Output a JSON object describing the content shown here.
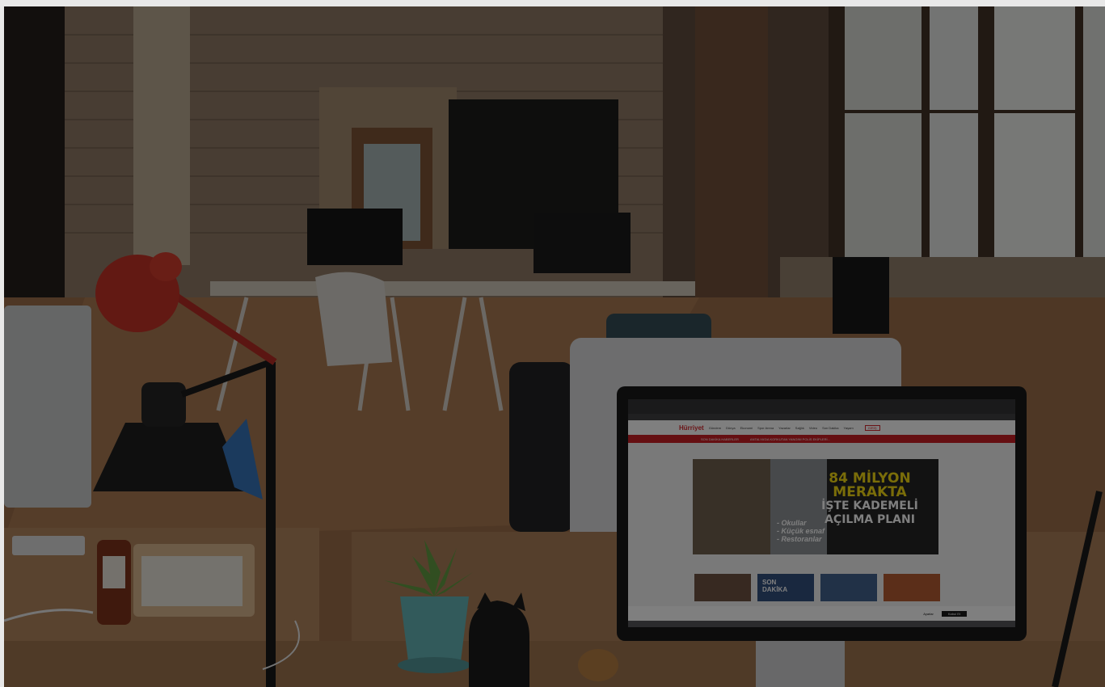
{
  "scene": {
    "description_icon": "office-photo",
    "overlay_color": "#0a0a0a"
  },
  "screen": {
    "site_logo": "Hürriyet",
    "menu_items": [
      "Gündem",
      "Dünya",
      "Ekonomi",
      "Spor Arena",
      "Yazarlar",
      "Sağlık",
      "Video",
      "Son Dakika",
      "Yaşam"
    ],
    "ticker_label": "SON DAKİKA HABERLER",
    "ticker_text": "ANTALYA'DA KORKUTAN YANGIN! POLİS EKİPLERİ...",
    "login_label": "GİRİŞ",
    "hero_lines": [
      "84 MİLYON",
      "MERAKTA",
      "İŞTE KADEMELİ",
      "AÇILMA PLANI"
    ],
    "hero_bullets": [
      "- Okullar",
      "- Küçük esnaf",
      "- Restoranlar"
    ],
    "son_dakika_badge": [
      "SON",
      "DAKİKA"
    ],
    "cookie_accept": "Kabul Et",
    "cookie_settings": "Ayarlar"
  }
}
